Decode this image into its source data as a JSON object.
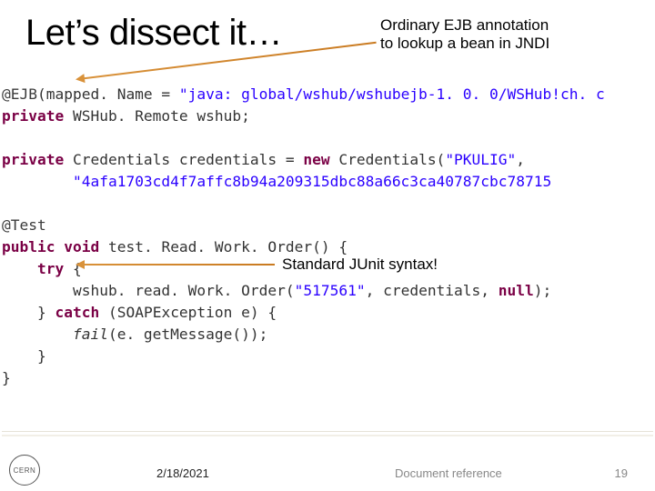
{
  "title": "Let’s dissect it…",
  "annotations": {
    "top_line1": "Ordinary EJB annotation",
    "top_line2": "to lookup a bean in JNDI",
    "mid": "Standard JUnit syntax!"
  },
  "code": {
    "l1_ann": "@EJB",
    "l1_rest": "(mapped. Name = ",
    "l1_str": "\"java: global/wshub/wshubejb-1. 0. 0/WSHub!ch. c",
    "l2_kw": "private ",
    "l2_type": "WSHub. Remote ",
    "l2_var": "wshub",
    "l2_end": ";",
    "l3_kw": "private ",
    "l3_type": "Credentials ",
    "l3_var": "credentials",
    "l3_mid": " = ",
    "l3_new": "new ",
    "l3_ctor": "Credentials(",
    "l3_str": "\"PKULIG\"",
    "l3_end": ",",
    "l4_str": "\"4afa1703cd4f7affc8b94a209315dbc88a66c3ca40787cbc78715",
    "l5_ann": "@Test",
    "l6_kw1": "public ",
    "l6_kw2": "void ",
    "l6_name": "test. Read. Work. Order",
    "l6_end": "() {",
    "l7_kw": "try ",
    "l7_end": "{",
    "l8_call": "wshub. read. Work. Order(",
    "l8_s1": "\"517561\"",
    "l8_mid": ", credentials, ",
    "l8_null": "null",
    "l8_end": ");",
    "l9_a": "} ",
    "l9_kw": "catch ",
    "l9_b": "(SOAPException e) {",
    "l10_call": "fail",
    "l10_rest": "(e. getMessage());",
    "l11": "}",
    "l12": "}"
  },
  "footer": {
    "date": "2/18/2021",
    "reference": "Document reference",
    "page": "19",
    "logo": "CERN"
  }
}
